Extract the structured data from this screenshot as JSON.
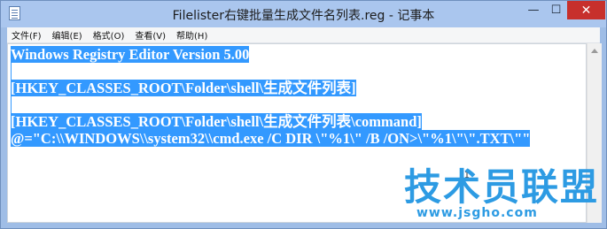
{
  "window": {
    "title": "Filelister右键批量生成文件名列表.reg - 记事本",
    "minimize_glyph": "—",
    "maximize_glyph": "☐",
    "close_glyph": "✕"
  },
  "menu": {
    "items": [
      {
        "label": "文件(F)"
      },
      {
        "label": "编辑(E)"
      },
      {
        "label": "格式(O)"
      },
      {
        "label": "查看(V)"
      },
      {
        "label": "帮助(H)"
      }
    ]
  },
  "editor": {
    "lines": [
      "Windows Registry Editor Version 5.00",
      "",
      "[HKEY_CLASSES_ROOT\\Folder\\shell\\生成文件列表]",
      "",
      "[HKEY_CLASSES_ROOT\\Folder\\shell\\生成文件列表\\command]",
      "@=\"C:\\\\WINDOWS\\\\system32\\\\cmd.exe /C DIR \\\"%1\\\" /B /ON>\\\"%1\\\"\\\".TXT\\\"\""
    ],
    "selection_color": "#3399ff"
  },
  "watermark": {
    "main": "技术员联盟",
    "sub": "www.jsgho.com"
  },
  "colors": {
    "title_bar": "#aac6ee",
    "close_button": "#c7302c",
    "watermark": "#2d9be3"
  }
}
